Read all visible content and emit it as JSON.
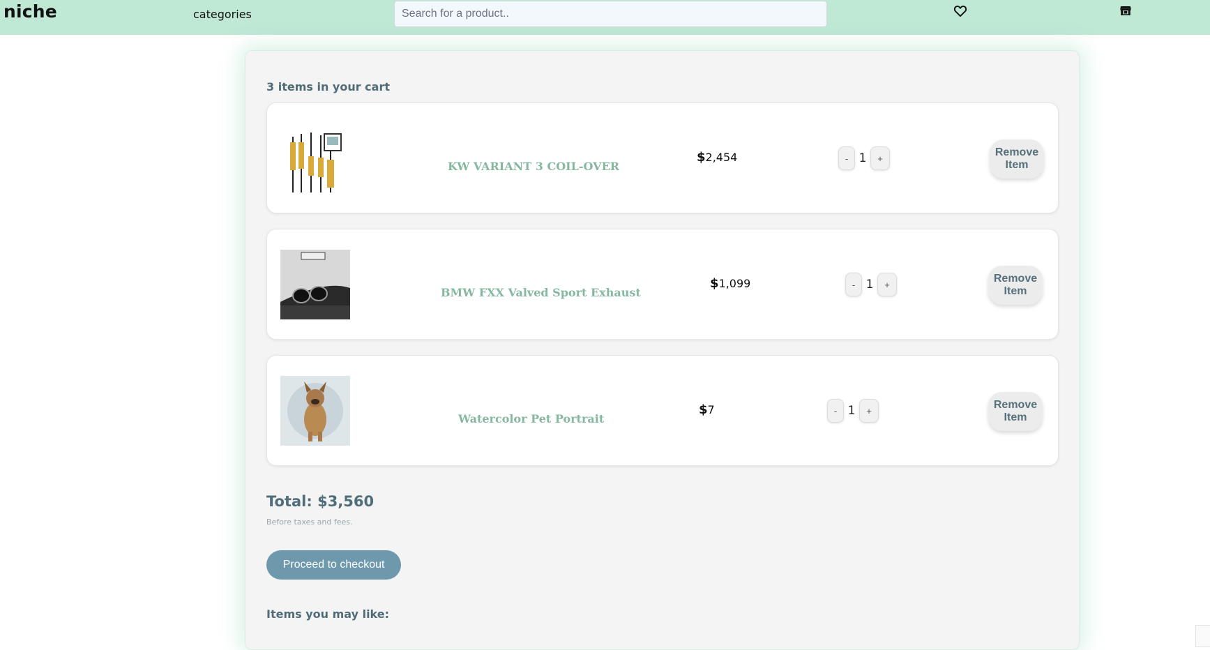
{
  "header": {
    "brand": "niche",
    "categories_label": "categories",
    "search_placeholder": "Search for a product..",
    "wishlist_icon": "heart-icon",
    "store_icon": "store-icon"
  },
  "cart": {
    "count_text": "3 items in your cart",
    "currency_symbol": "$",
    "items": [
      {
        "name": "KW VARIANT 3 COIL-OVER",
        "price": "2,454",
        "quantity": "1",
        "minus": "-",
        "plus": "+",
        "remove_label": "Remove Item",
        "thumb_icon": "coilover-image"
      },
      {
        "name": "BMW FXX Valved Sport Exhaust",
        "price": "1,099",
        "quantity": "1",
        "minus": "-",
        "plus": "+",
        "remove_label": "Remove Item",
        "thumb_icon": "exhaust-image"
      },
      {
        "name": "Watercolor Pet Portrait",
        "price": "7",
        "quantity": "1",
        "minus": "-",
        "plus": "+",
        "remove_label": "Remove Item",
        "thumb_icon": "pet-portrait-image"
      }
    ],
    "total_text": "Total: $3,560",
    "total_note": "Before taxes and fees.",
    "checkout_label": "Proceed to checkout",
    "recommendations_heading": "Items you may like:"
  },
  "colors": {
    "topbar": "#bfe8d5",
    "accent": "#86b8a0",
    "checkout_button": "#6e98ab",
    "heading_text": "#506c77"
  }
}
